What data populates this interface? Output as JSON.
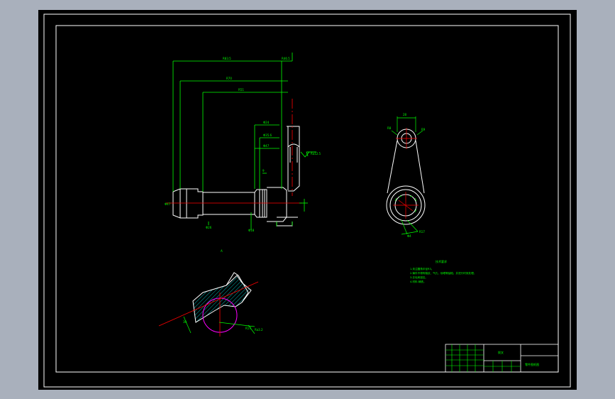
{
  "view": {
    "paper_color": "#000000",
    "background_color": "#a9b0bc",
    "colors": {
      "outline": "#ffffff",
      "dimension": "#00ff00",
      "centerline": "#ff0000",
      "hidden": "#ff00ff",
      "hatch": "#00ffff",
      "text": "#00ff00"
    }
  },
  "drawing": {
    "main_view": {
      "dims_top": [
        "R83.5",
        "R70",
        "R51",
        "R46.5"
      ],
      "dims_mid": [
        "Φ24",
        "Φ35.6",
        "Φ47"
      ],
      "dims_side": [
        "Φ47",
        "Φ18",
        "Φ26"
      ],
      "roughness": "Ra12.5",
      "hint": "9"
    },
    "side_view": {
      "dims": [
        "28",
        "R8",
        "R9",
        "R17",
        "Φ4"
      ]
    },
    "section_view": {
      "label": "A",
      "dims": [
        "30",
        "R17",
        "Ra3.2"
      ]
    },
    "notes": {
      "title": "技术要求",
      "lines": [
        "1.未注圆角半径R3。",
        "2.铸件不得有裂纹、气孔、砂眼等缺陷，并进行时效处理。",
        "3.去毛刺锐边。",
        "4.材料:铸铁。"
      ]
    },
    "title_block": {
      "part_name": "拨叉",
      "drawing_title": "零件图纸图"
    }
  }
}
